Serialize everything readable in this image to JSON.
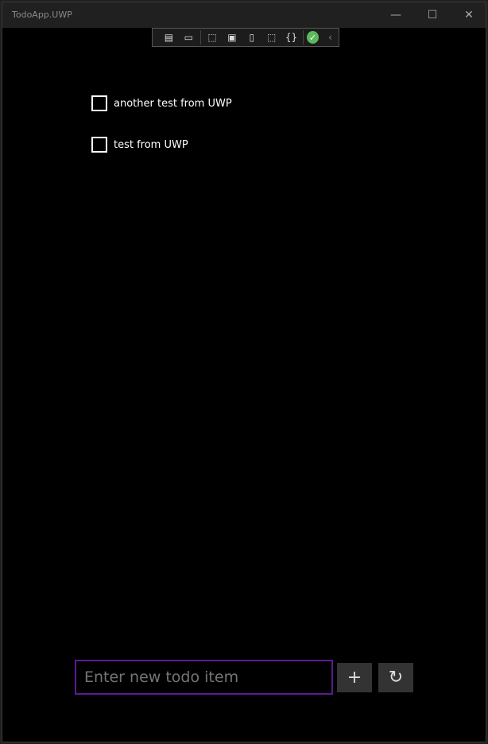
{
  "window": {
    "title": "TodoApp.UWP",
    "minimize": "—",
    "maximize": "☐",
    "close": "✕"
  },
  "toolbar": {
    "icons": [
      "live-visual-tree-icon",
      "record-icon",
      "select-element-icon",
      "display-layout-adorners-icon",
      "track-focus-icon",
      "preview-selection-icon",
      "binding-failures-icon",
      "status-ok-icon",
      "collapse-icon"
    ]
  },
  "todos": [
    {
      "label": "another test from UWP",
      "checked": false
    },
    {
      "label": "test from UWP",
      "checked": false
    }
  ],
  "composer": {
    "placeholder": "Enter new todo item",
    "add": "+",
    "refresh": "↻"
  },
  "colors": {
    "accent": "#5d1a92"
  }
}
